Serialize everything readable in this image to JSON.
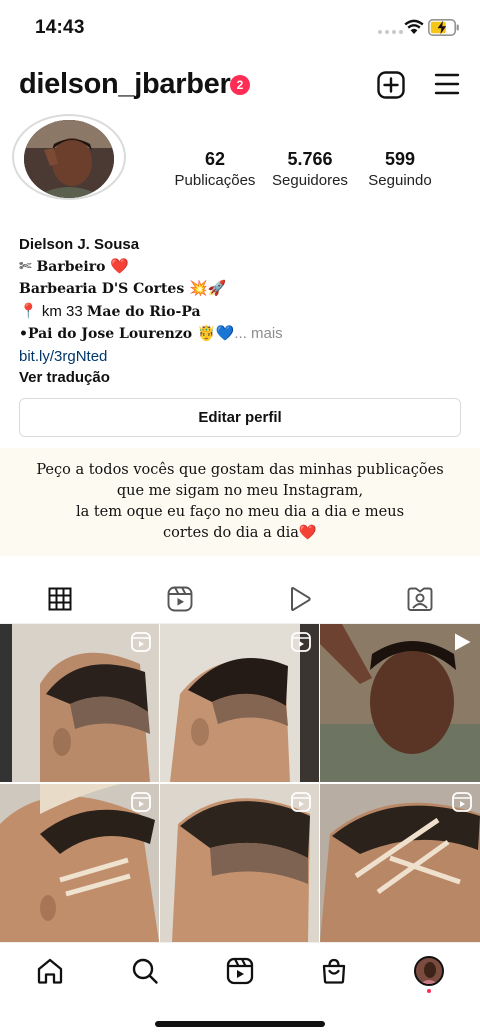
{
  "status_bar": {
    "time": "14:43"
  },
  "header": {
    "username": "dielson_jbarber",
    "notification_count": "2"
  },
  "stats": [
    {
      "value": "62",
      "label": "Publicações"
    },
    {
      "value": "5.766",
      "label": "Seguidores"
    },
    {
      "value": "599",
      "label": "Seguindo"
    }
  ],
  "bio": {
    "name": "Dielson J. Sousa ",
    "apple_glyph": "",
    "line1_icon": "✄",
    "line1_text": " Barbeiro ",
    "line1_emoji": "❤️",
    "line2_text": "Barbearia D'S Cortes ",
    "line2_emoji": "💥🚀",
    "line3_emoji": "📍",
    "line3_plain": " km 33 ",
    "line3_serif": "Mae do Rio-Pa",
    "line4_serif": "•Pai do Jose Lourenzo ",
    "line4_emoji": "🤴💙",
    "more": "... mais",
    "link": "bit.ly/3rgNted",
    "translate": "Ver tradução"
  },
  "edit_profile": "Editar perfil",
  "overlay_caption": {
    "line1": "Peço a todos vocês que gostam das minhas publicações",
    "line2": "que me sigam no meu Instagram,",
    "line3": "la tem oque eu faço no meu dia a dia e meus",
    "line4": "cortes do dia a dia",
    "line4_emoji": "❤️"
  },
  "tabs": [
    "grid-icon",
    "reels-icon",
    "video-play-icon",
    "tagged-icon"
  ],
  "active_tab": "grid-icon",
  "posts": [
    {
      "type": "reel",
      "subject": "fade haircut side view"
    },
    {
      "type": "reel",
      "subject": "fade haircut side view"
    },
    {
      "type": "video",
      "subject": "selfie portrait"
    },
    {
      "type": "reel",
      "subject": "haircut with line design"
    },
    {
      "type": "reel",
      "subject": "fade haircut back view"
    },
    {
      "type": "reel",
      "subject": "haircut with line design"
    }
  ],
  "bottom_nav": [
    "home-icon",
    "search-icon",
    "reels-icon",
    "shop-icon",
    "profile-avatar"
  ],
  "colors": {
    "badge": "#ff2d55",
    "link": "#00376b",
    "muted": "#8e8e8e",
    "border": "#dbdbdb",
    "heart": "#e0245e",
    "blue_heart": "#3b82f6"
  }
}
